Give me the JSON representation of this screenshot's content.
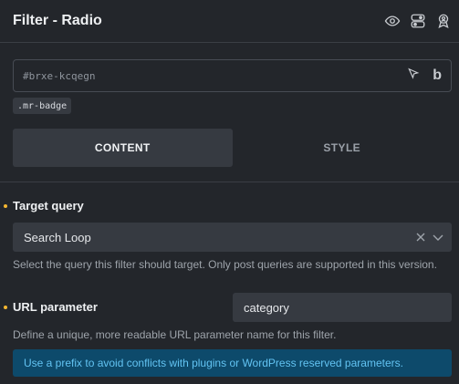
{
  "panel": {
    "title": "Filter - Radio",
    "icons": [
      "eye-icon",
      "toggle-icon",
      "user-badge-icon"
    ]
  },
  "id_field": {
    "value": "#brxe-kcqegn",
    "icons": [
      "cursor-icon",
      "bold-b-icon"
    ],
    "b_letter": "b"
  },
  "class_badge": ".mr-badge",
  "tabs": [
    {
      "label": "CONTENT",
      "active": true
    },
    {
      "label": "STYLE",
      "active": false
    }
  ],
  "target_query": {
    "label": "Target query",
    "value": "Search Loop",
    "help": "Select the query this filter should target. Only post queries are supported in this version."
  },
  "url_parameter": {
    "label": "URL parameter",
    "value": "category",
    "help": "Define a unique, more readable URL parameter name for this filter.",
    "notice": "Use a prefix to avoid conflicts with plugins or WordPress reserved parameters."
  },
  "colors": {
    "background": "#23262b",
    "field": "#363a41",
    "required_dot": "#f5b731",
    "notice_bg": "#0d4a6b",
    "notice_text": "#62c3f2"
  }
}
